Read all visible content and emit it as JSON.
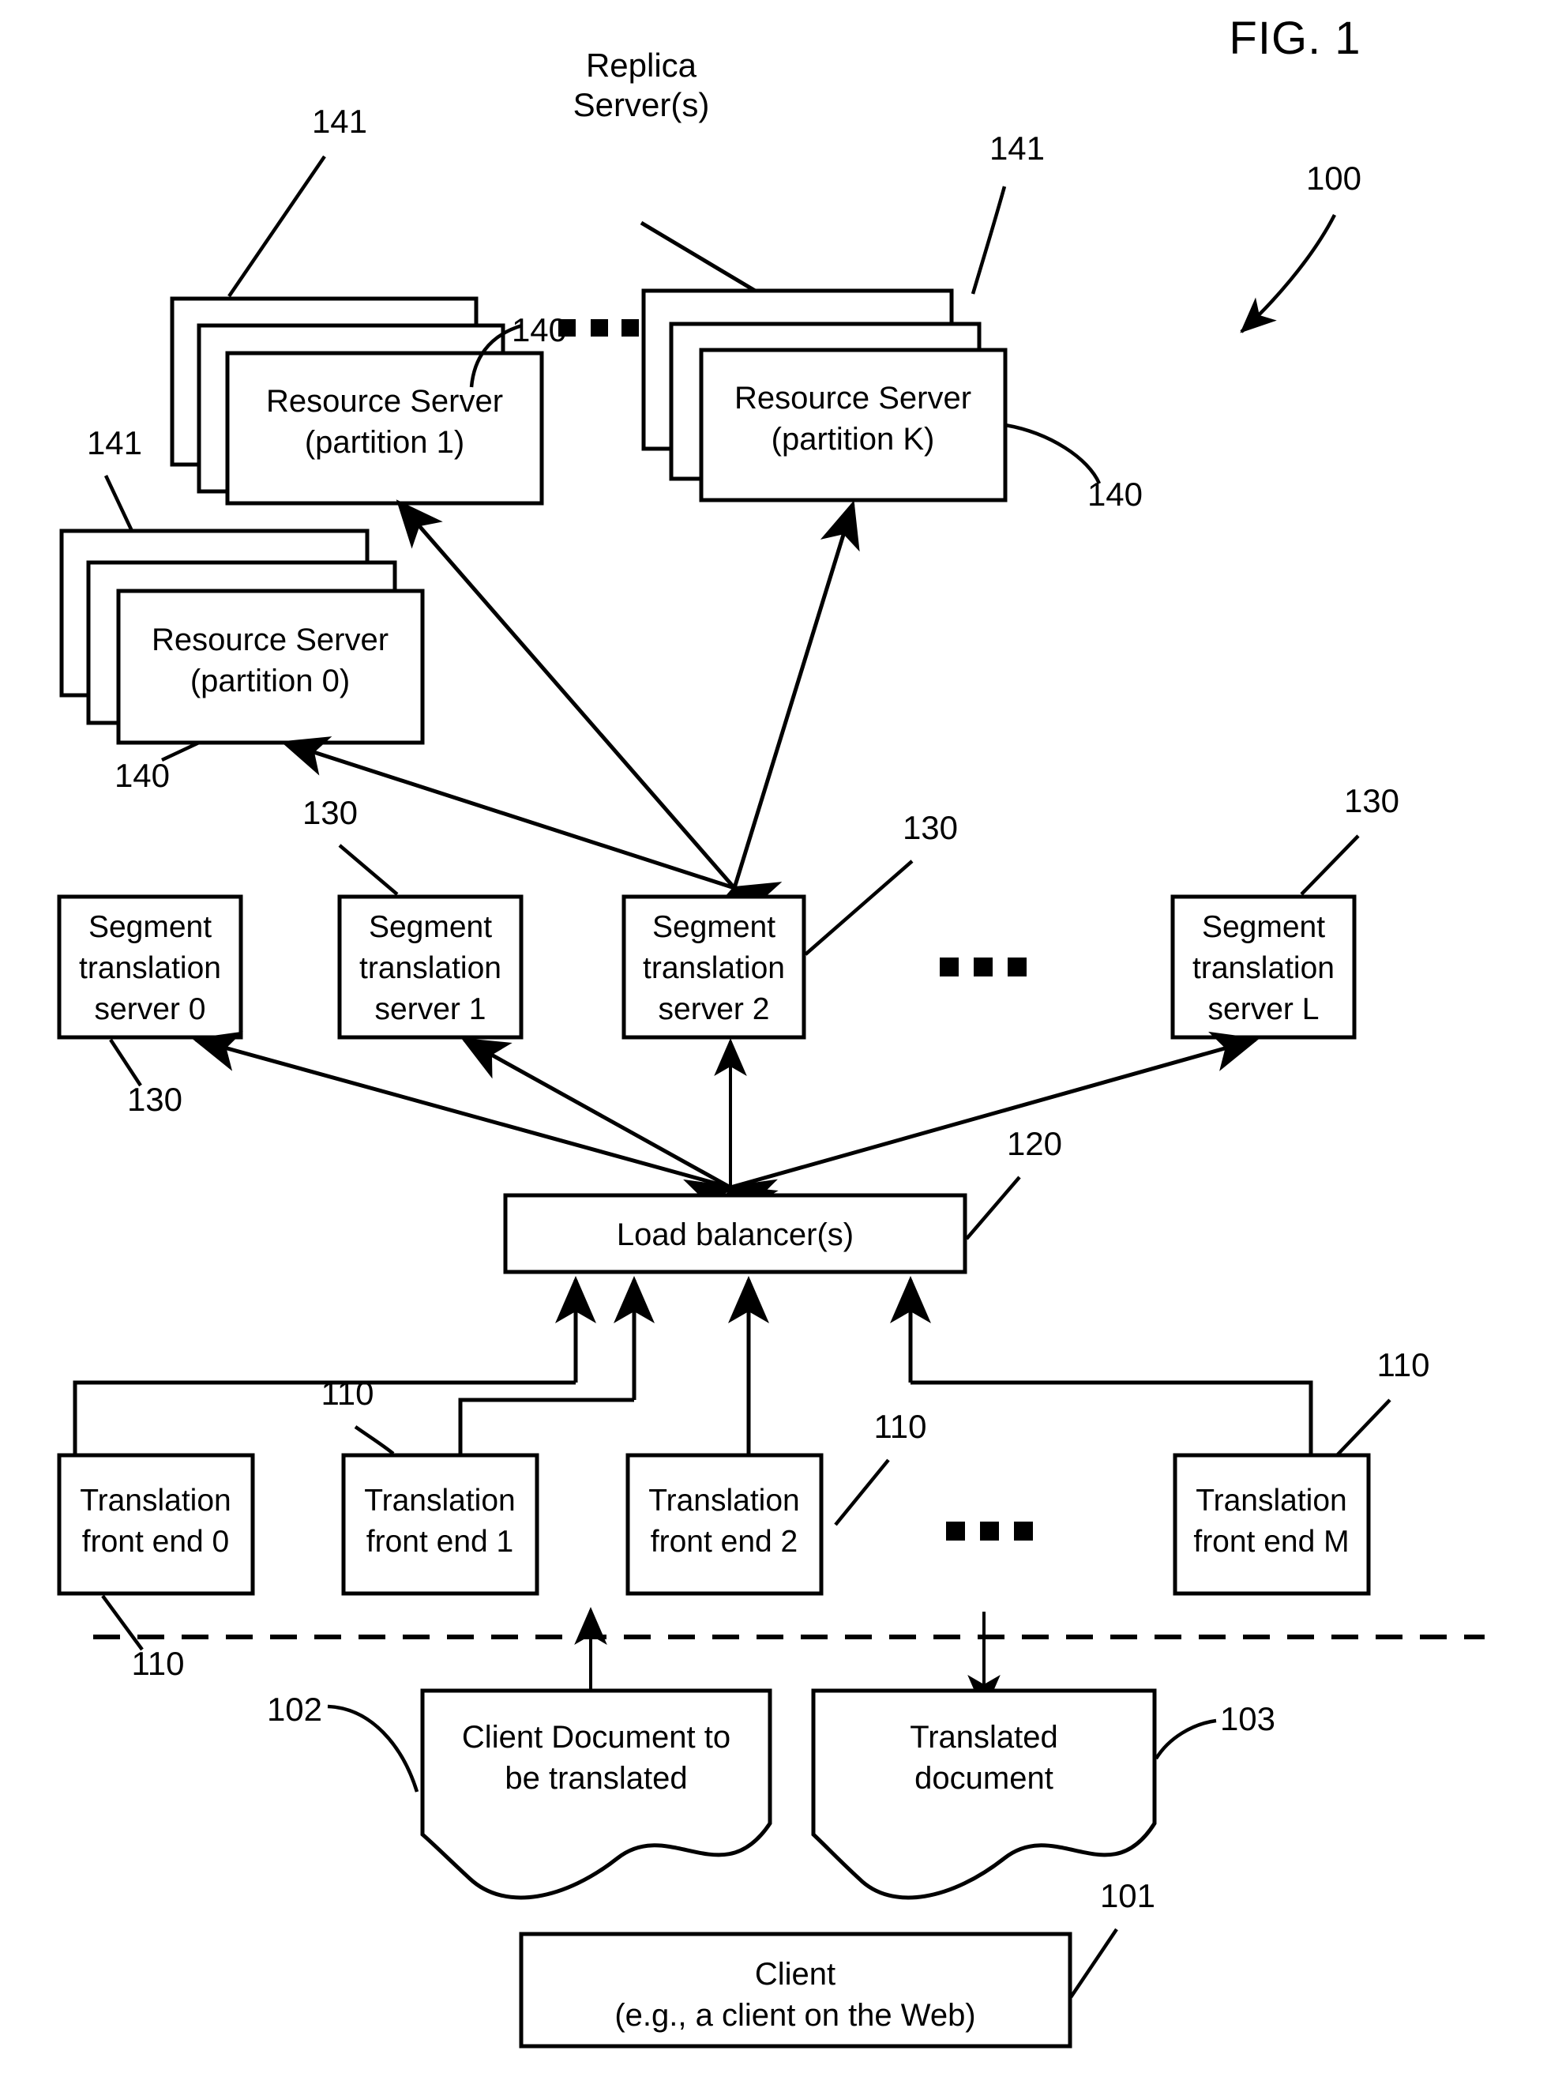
{
  "figure": {
    "title": "FIG. 1",
    "system_ref": "100"
  },
  "labels": {
    "replica_servers": [
      "Replica",
      "Server(s)"
    ]
  },
  "resource_servers": [
    {
      "ref_stack": "141",
      "ref_box": "140",
      "line1": "Resource Server",
      "line2": "(partition 1)"
    },
    {
      "ref_stack": "141",
      "ref_box": "140",
      "line1": "Resource Server",
      "line2": "(partition K)"
    },
    {
      "ref_stack": "141",
      "ref_box": "140",
      "line1": "Resource Server",
      "line2": "(partition 0)"
    }
  ],
  "segment_translation_servers": [
    {
      "ref": "130",
      "line1": "Segment",
      "line2": "translation",
      "line3": "server 0"
    },
    {
      "ref": "130",
      "line1": "Segment",
      "line2": "translation",
      "line3": "server 1"
    },
    {
      "ref": "130",
      "line1": "Segment",
      "line2": "translation",
      "line3": "server 2"
    },
    {
      "ref": "130",
      "line1": "Segment",
      "line2": "translation",
      "line3": "server L"
    }
  ],
  "load_balancer": {
    "label": "Load balancer(s)",
    "ref": "120"
  },
  "translation_front_ends": [
    {
      "ref": "110",
      "line1": "Translation",
      "line2": "front end 0"
    },
    {
      "ref": "110",
      "line1": "Translation",
      "line2": "front end 1"
    },
    {
      "ref": "110",
      "line1": "Translation",
      "line2": "front end 2"
    },
    {
      "ref": "110",
      "line1": "Translation",
      "line2": "front end M"
    }
  ],
  "documents": [
    {
      "ref": "102",
      "line1": "Client Document to",
      "line2": "be translated"
    },
    {
      "ref": "103",
      "line1": "Translated",
      "line2": "document"
    }
  ],
  "client": {
    "ref": "101",
    "line1": "Client",
    "line2": "(e.g., a client on the Web)"
  },
  "ellipsis": {
    "glyph": "■ ■ ■"
  }
}
